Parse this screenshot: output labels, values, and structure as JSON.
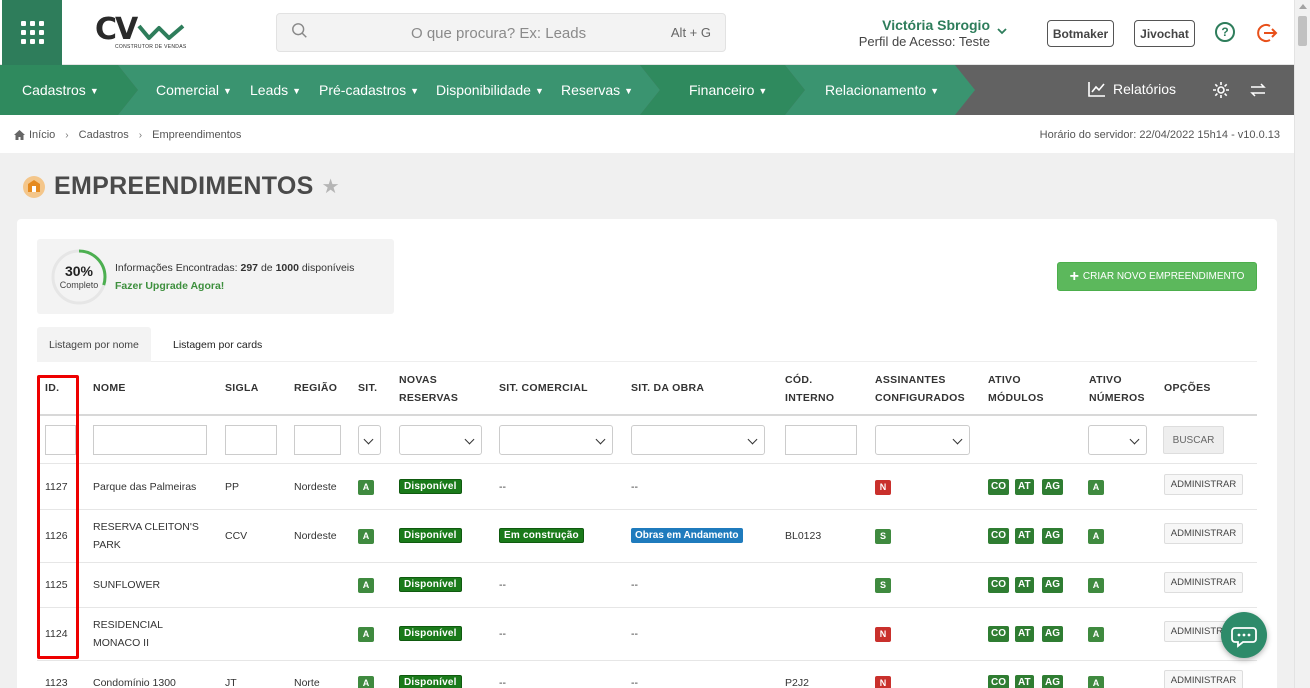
{
  "header": {
    "search_placeholder": "O que procura? Ex: Leads",
    "search_shortcut": "Alt + G",
    "user_name": "Victória Sbrogio",
    "user_profile": "Perfil de Acesso: Teste",
    "btn_botmaker": "Botmaker",
    "btn_jivochat": "Jivochat",
    "help_symbol": "?",
    "logo_text": "CV",
    "logo_sub": "CONSTRUTOR DE VENDAS"
  },
  "nav": {
    "items": [
      "Cadastros",
      "Comercial",
      "Leads",
      "Pré-cadastros",
      "Disponibilidade",
      "Reservas",
      "Financeiro",
      "Relacionamento"
    ],
    "relatorios": "Relatórios"
  },
  "breadcrumb": [
    "Início",
    "Cadastros",
    "Empreendimentos"
  ],
  "server_time": "Horário do servidor: 22/04/2022 15h14 - v10.0.13",
  "page_title": "EMPREENDIMENTOS",
  "info": {
    "percent": "30%",
    "percent_value": 30,
    "percent_label": "Completo",
    "found_prefix": "Informações Encontradas:",
    "found_count": "297",
    "found_of": "de",
    "found_total": "1000",
    "found_suffix": "disponíveis",
    "upgrade": "Fazer Upgrade Agora!"
  },
  "new_button": "CRIAR NOVO EMPREENDIMENTO",
  "tabs": [
    "Listagem por nome",
    "Listagem por cards"
  ],
  "table": {
    "headers": {
      "id": "ID.",
      "nome": "NOME",
      "sigla": "SIGLA",
      "regiao": "REGIÃO",
      "sit": "SIT.",
      "novas_l1": "NOVAS",
      "novas_l2": "RESERVAS",
      "sit_comercial": "SIT. COMERCIAL",
      "sit_obra": "SIT. DA OBRA",
      "cod_l1": "CÓD.",
      "cod_l2": "INTERNO",
      "assin_l1": "ASSINANTES",
      "assin_l2": "CONFIGURADOS",
      "mod_l1": "ATIVO",
      "mod_l2": "MÓDULOS",
      "num_l1": "ATIVO",
      "num_l2": "NÚMEROS",
      "opcoes": "OPÇÕES"
    },
    "buscar": "BUSCAR",
    "admin": "ADMINISTRAR",
    "rows": [
      {
        "id": "1127",
        "nome_l1": "Parque das Palmeiras",
        "nome_l2": "",
        "sigla": "PP",
        "regiao": "Nordeste",
        "sit": "A",
        "novas": "Disponível",
        "comercial": "--",
        "obra": "--",
        "cod": "",
        "assin": "N",
        "mods": [
          "CO",
          "AT",
          "AG"
        ],
        "num": "A"
      },
      {
        "id": "1126",
        "nome_l1": "RESERVA CLEITON'S",
        "nome_l2": "PARK",
        "sigla": "CCV",
        "regiao": "Nordeste",
        "sit": "A",
        "novas": "Disponível",
        "comercial": "Em construção",
        "obra": "Obras em Andamento",
        "cod": "BL0123",
        "assin": "S",
        "mods": [
          "CO",
          "AT",
          "AG"
        ],
        "num": "A"
      },
      {
        "id": "1125",
        "nome_l1": "SUNFLOWER",
        "nome_l2": "",
        "sigla": "",
        "regiao": "",
        "sit": "A",
        "novas": "Disponível",
        "comercial": "--",
        "obra": "--",
        "cod": "",
        "assin": "S",
        "mods": [
          "CO",
          "AT",
          "AG"
        ],
        "num": "A"
      },
      {
        "id": "1124",
        "nome_l1": "RESIDENCIAL",
        "nome_l2": "MONACO II",
        "sigla": "",
        "regiao": "",
        "sit": "A",
        "novas": "Disponível",
        "comercial": "--",
        "obra": "--",
        "cod": "",
        "assin": "N",
        "mods": [
          "CO",
          "AT",
          "AG"
        ],
        "num": "A"
      },
      {
        "id": "1123",
        "nome_l1": "Condomínio 1300",
        "nome_l2": "",
        "sigla": "JT",
        "regiao": "Norte",
        "sit": "A",
        "novas": "Disponível",
        "comercial": "--",
        "obra": "--",
        "cod": "P2J2",
        "assin": "N",
        "mods": [
          "CO",
          "AT",
          "AG"
        ],
        "num": "A"
      }
    ]
  },
  "colors": {
    "brand_green": "#2e7d5b",
    "nav_gray": "#626262",
    "badge_green": "#1a7a1a",
    "badge_red": "#c9302c",
    "badge_blue": "#1f7bbd",
    "highlight_red": "#e00000"
  },
  "icons": [
    "apps-grid-icon",
    "search-icon",
    "chevron-down-icon",
    "help-icon",
    "logout-icon",
    "chart-icon",
    "gear-icon",
    "swap-icon",
    "home-icon",
    "building-icon",
    "star-icon",
    "plus-icon",
    "chat-icon"
  ]
}
